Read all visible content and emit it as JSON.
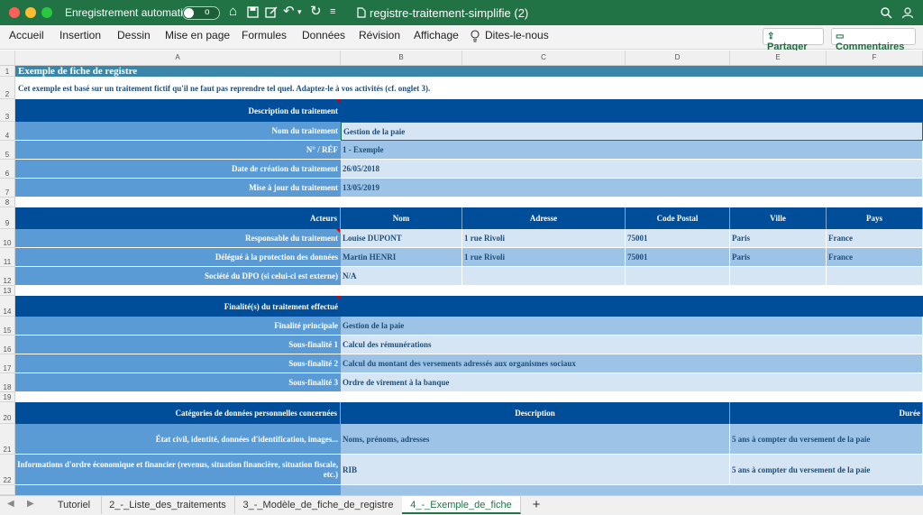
{
  "window": {
    "autosave_label": "Enregistrement automatique",
    "autosave_state": "o",
    "document_title": "registre-traitement-simplifie (2)",
    "colors": {
      "titlebar": "#217346",
      "header_blue": "#004e9a",
      "label_blue": "#5b9bd5",
      "value_light": "#d6e5f3",
      "value_mid": "#9dc3e6"
    }
  },
  "ribbon": {
    "tabs": [
      "Accueil",
      "Insertion",
      "Dessin",
      "Mise en page",
      "Formules",
      "Données",
      "Révision",
      "Affichage"
    ],
    "tell_me": "Dites-le-nous",
    "share": "Partager",
    "comments": "Commentaires"
  },
  "columns": [
    "A",
    "B",
    "C",
    "D",
    "E",
    "F"
  ],
  "rows": [
    "1",
    "2",
    "3",
    "4",
    "5",
    "6",
    "7",
    "8",
    "9",
    "10",
    "11",
    "12",
    "13",
    "14",
    "15",
    "16",
    "17",
    "18",
    "19",
    "20",
    "21",
    "22"
  ],
  "sheet": {
    "title": "Exemple de fiche de registre",
    "intro": "Cet exemple est basé sur un traitement fictif qu'il ne faut pas reprendre tel quel. Adaptez-le à vos activités (cf. onglet 3).",
    "description": {
      "header": "Description  du traitement",
      "rows": [
        {
          "label": "Nom du traitement",
          "value": "Gestion de la paie"
        },
        {
          "label": "N° / RÉF",
          "value": "1 - Exemple"
        },
        {
          "label": "Date de création du traitement",
          "value": "26/05/2018"
        },
        {
          "label": "Mise à jour du traitement",
          "value": "13/05/2019"
        }
      ]
    },
    "actors": {
      "header": "Acteurs",
      "columns": [
        "Nom",
        "Adresse",
        "Code Postal",
        "Ville",
        "Pays"
      ],
      "rows": [
        {
          "label": "Responsable du traitement",
          "cells": [
            "Louise DUPONT",
            "1 rue Rivoli",
            "75001",
            "Paris",
            "France"
          ]
        },
        {
          "label": "Délégué à la protection des données",
          "cells": [
            "Martin HENRI",
            "1 rue Rivoli",
            "75001",
            "Paris",
            "France"
          ]
        },
        {
          "label": "Société du DPO (si celui-ci est externe)",
          "cells": [
            "N/A",
            "",
            "",
            "",
            ""
          ]
        }
      ]
    },
    "purposes": {
      "header": "Finalité(s) du traitement effectué",
      "rows": [
        {
          "label": "Finalité principale",
          "value": "Gestion de la paie"
        },
        {
          "label": "Sous-finalité 1",
          "value": "Calcul des rémunérations"
        },
        {
          "label": "Sous-finalité 2",
          "value": "Calcul du montant des versements adressés aux organismes sociaux"
        },
        {
          "label": "Sous-finalité 3",
          "value": "Ordre de virement à la banque"
        }
      ]
    },
    "categories": {
      "header": "Catégories de données personnelles concernées",
      "col_description": "Description",
      "col_duration": "Durée",
      "rows": [
        {
          "label": "État civil, identité, données d'identification, images...",
          "description": "Noms, prénoms, adresses",
          "duration": "5 ans à compter du versement de la paie"
        },
        {
          "label": "Informations d'ordre économique et financier (revenus, situation financière, situation fiscale, etc.)",
          "description": "RIB",
          "duration": "5 ans à compter du versement de la paie"
        }
      ]
    }
  },
  "tabs": [
    "Tutoriel",
    "2_-_Liste_des_traitements",
    "3_-_Modèle_de_fiche_de_registre",
    "4_-_Exemple_de_fiche"
  ],
  "active_tab": "4_-_Exemple_de_fiche",
  "add_sheet": "+"
}
